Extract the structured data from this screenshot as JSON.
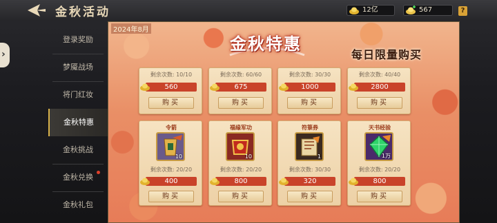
{
  "header": {
    "title": "金秋活动",
    "gold_amount": "12亿",
    "ingot_amount": "567",
    "help_label": "?"
  },
  "sidebar": {
    "items": [
      {
        "label": "登录奖励",
        "active": false,
        "dot": false
      },
      {
        "label": "梦魇战场",
        "active": false,
        "dot": false
      },
      {
        "label": "将门红妆",
        "active": false,
        "dot": false
      },
      {
        "label": "金秋特惠",
        "active": true,
        "dot": false
      },
      {
        "label": "金秋挑战",
        "active": false,
        "dot": false
      },
      {
        "label": "金秋兑换",
        "active": false,
        "dot": true
      },
      {
        "label": "金秋礼包",
        "active": false,
        "dot": false
      }
    ]
  },
  "panel": {
    "date": "2024年8月",
    "banner_title": "金秋特惠",
    "banner_subtitle": "每日限量购买"
  },
  "deals_top": [
    {
      "remaining": "剩余次数: 10/10",
      "price": "560",
      "buy_label": "购买"
    },
    {
      "remaining": "剩余次数: 60/60",
      "price": "675",
      "buy_label": "购买"
    },
    {
      "remaining": "剩余次数: 30/30",
      "price": "1000",
      "buy_label": "购买"
    },
    {
      "remaining": "剩余次数: 40/40",
      "price": "2800",
      "buy_label": "购买"
    }
  ],
  "deals_bottom": [
    {
      "item_name": "令箭",
      "count": "10",
      "remaining": "剩余次数: 20/20",
      "price": "400",
      "buy_label": "购买",
      "icon": "token-arrow-icon",
      "color": "#6a5a8a"
    },
    {
      "item_name": "福缘军功",
      "count": "10",
      "remaining": "剩余次数: 20/20",
      "price": "800",
      "buy_label": "购买",
      "icon": "war-merit-icon",
      "color": "#8a2a22"
    },
    {
      "item_name": "符箓券",
      "count": "1",
      "remaining": "剩余次数: 30/30",
      "price": "320",
      "buy_label": "购买",
      "icon": "talisman-scroll-icon",
      "color": "#3a2a20"
    },
    {
      "item_name": "天书经验",
      "count": "1万",
      "remaining": "剩余次数: 20/20",
      "price": "800",
      "buy_label": "购买",
      "icon": "jade-exp-icon",
      "color": "#4a2a6a"
    }
  ]
}
